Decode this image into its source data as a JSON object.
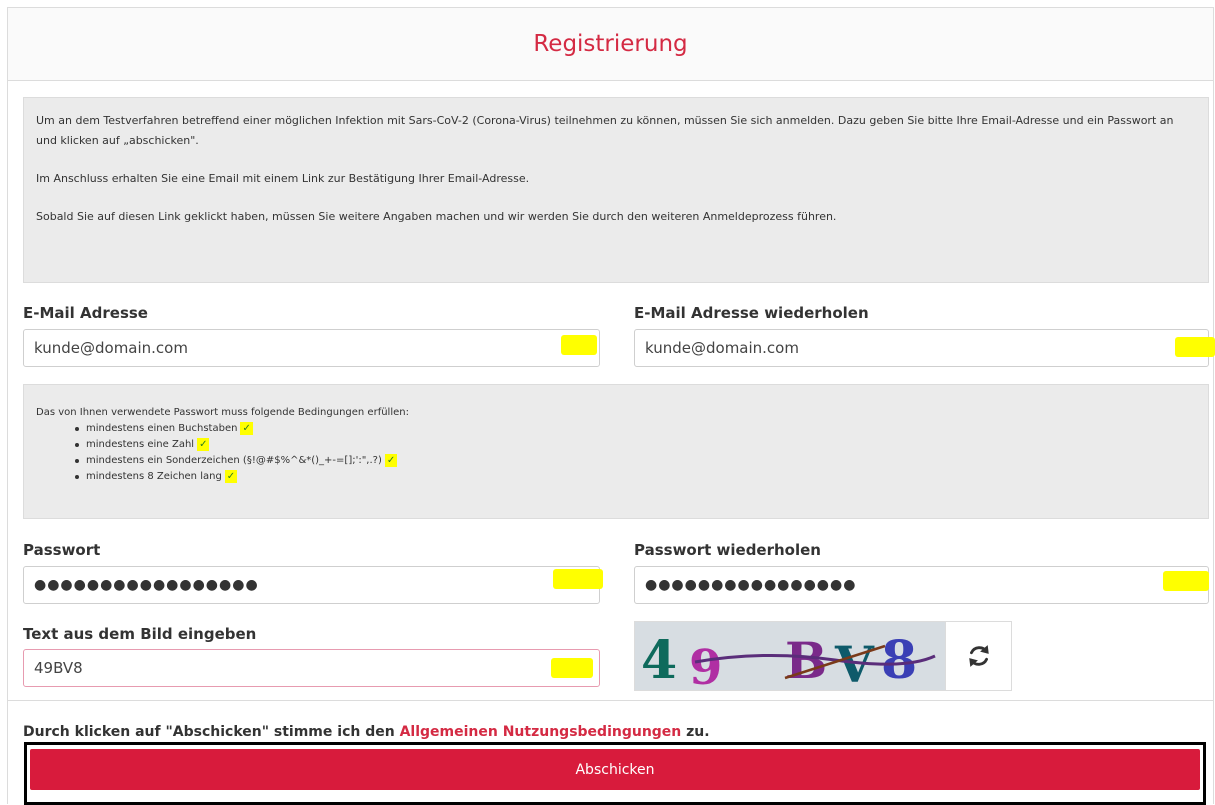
{
  "header": {
    "title": "Registrierung"
  },
  "info": {
    "paragraphs": [
      "Um an dem Testverfahren betreffend einer möglichen Infektion mit Sars-CoV-2 (Corona-Virus) teilnehmen zu können, müssen Sie sich anmelden. Dazu geben Sie bitte Ihre Email-Adresse und ein Passwort an und klicken auf „abschicken\".",
      "Im Anschluss erhalten Sie eine Email mit einem Link zur Bestätigung Ihrer Email-Adresse.",
      "Sobald Sie auf diesen Link geklickt haben, müssen Sie weitere Angaben machen und wir werden Sie durch den weiteren Anmeldeprozess führen."
    ]
  },
  "email": {
    "label": "E-Mail Adresse",
    "value": "kunde@domain.com"
  },
  "email_repeat": {
    "label": "E-Mail Adresse wiederholen",
    "value": "kunde@domain.com"
  },
  "password_rules": {
    "intro": "Das von Ihnen verwendete Passwort muss folgende Bedingungen erfüllen:",
    "items": [
      {
        "text": "mindestens einen Buchstaben",
        "check": "✓"
      },
      {
        "text": "mindestens eine Zahl",
        "check": "✓"
      },
      {
        "text": "mindestens ein Sonderzeichen (§!@#$%^&*()_+-=[];':\",.?)",
        "check": "✓"
      },
      {
        "text": "mindestens 8 Zeichen lang",
        "check": "✓"
      }
    ]
  },
  "password": {
    "label": "Passwort",
    "value": "●●●●●●●●●●●●●●●●●"
  },
  "password_repeat": {
    "label": "Passwort wiederholen",
    "value": "●●●●●●●●●●●●●●●●"
  },
  "captcha": {
    "label": "Text aus dem Bild eingeben",
    "value": "49BV8",
    "image_text": [
      "4",
      "9",
      "B",
      "V",
      "8"
    ],
    "refresh_icon": "refresh-icon"
  },
  "terms": {
    "prefix": "Durch klicken auf \"Abschicken\" stimme ich den ",
    "link": "Allgemeinen Nutzungsbedingungen",
    "suffix": " zu."
  },
  "submit": {
    "label": "Abschicken"
  },
  "colors": {
    "accent": "#d81b3c",
    "title": "#d42a43",
    "highlight": "#ffff00"
  }
}
